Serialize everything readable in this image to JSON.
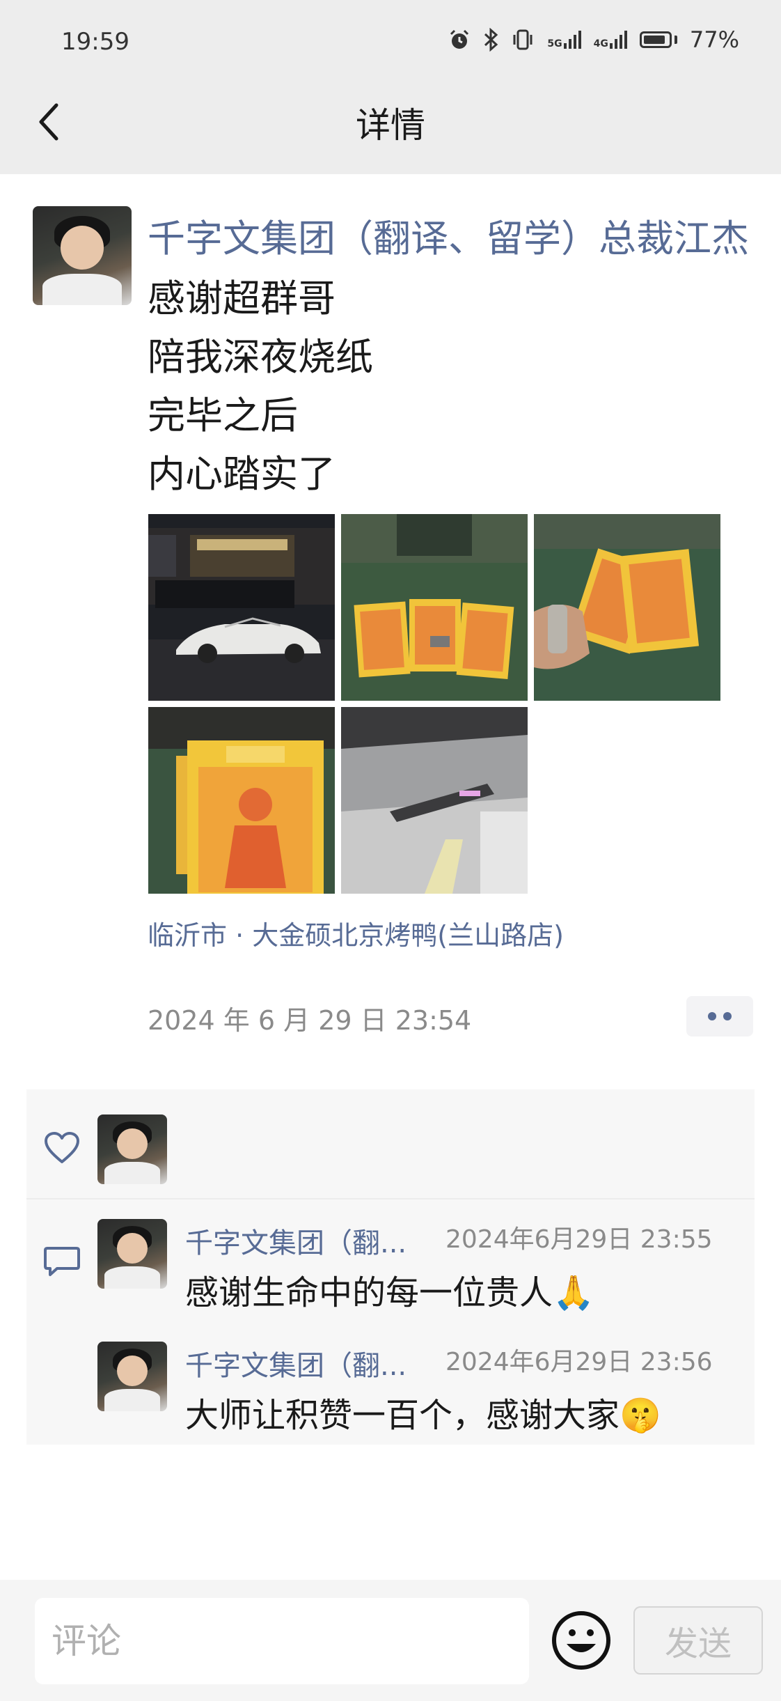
{
  "status_bar": {
    "time": "19:59",
    "net1": "5G",
    "net2": "4G",
    "battery": "77%"
  },
  "header": {
    "title": "详情"
  },
  "post": {
    "author": "千字文集团（翻译、留学）总裁江杰",
    "lines": [
      "感谢超群哥",
      "陪我深夜烧纸",
      "完毕之后",
      "内心踏实了"
    ],
    "location": "临沂市 · 大金硕北京烤鸭(兰山路店)",
    "time": "2024 年 6 月 29 日 23:54"
  },
  "comments": [
    {
      "name": "千字文集团（翻...",
      "time": "2024年6月29日 23:55",
      "text": "感谢生命中的每一位贵人🙏"
    },
    {
      "name": "千字文集团（翻...",
      "time": "2024年6月29日 23:56",
      "text": "大师让积赞一百个，感谢大家🤫"
    }
  ],
  "bottom_bar": {
    "placeholder": "评论",
    "send_label": "发送"
  },
  "colors": {
    "link": "#576b95",
    "background": "#ededed",
    "panel": "#f7f7f7"
  },
  "icons": [
    "alarm-icon",
    "bluetooth-icon",
    "vibrate-icon",
    "signal-icon",
    "battery-icon",
    "back-chevron-icon",
    "more-icon",
    "heart-icon",
    "comment-bubble-icon",
    "emoji-icon"
  ]
}
